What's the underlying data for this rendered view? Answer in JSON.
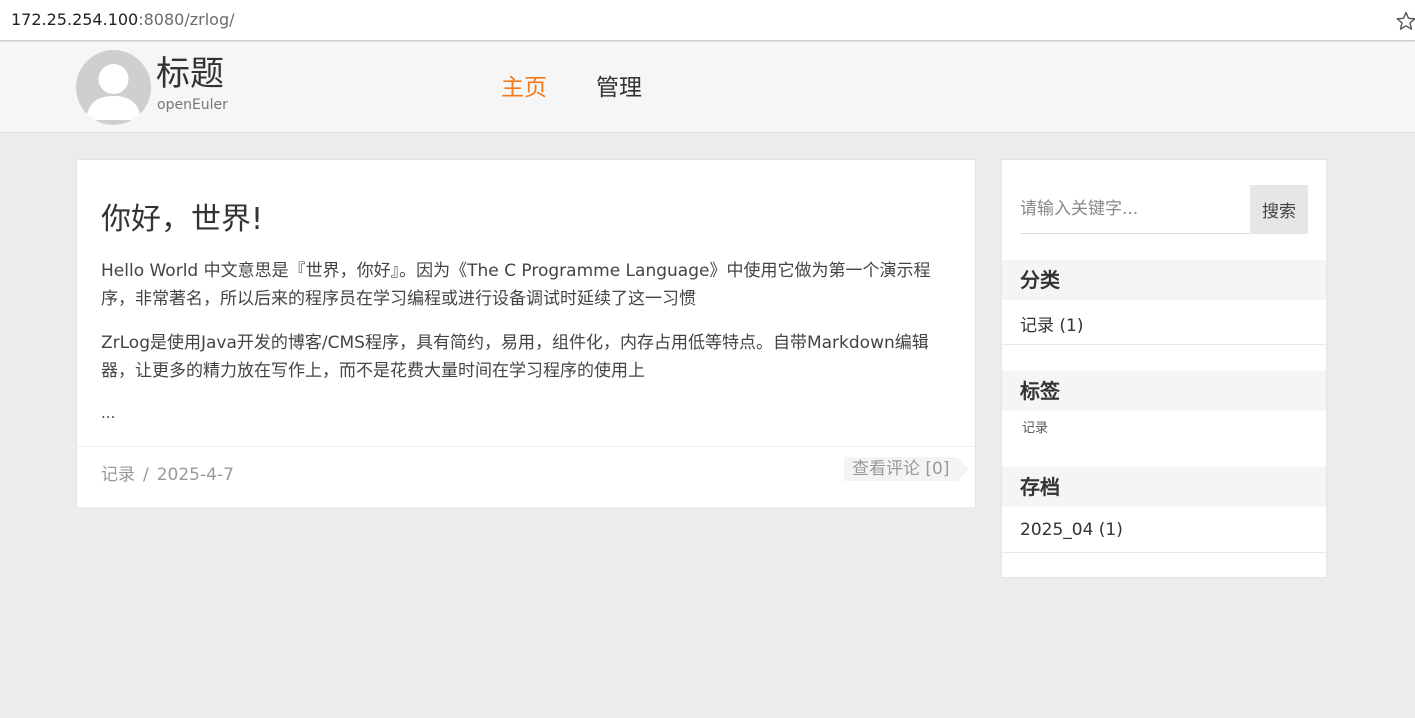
{
  "browser": {
    "url_host": "172.25.254.100",
    "url_rest": ":8080/zrlog/"
  },
  "header": {
    "title": "标题",
    "subtitle": "openEuler",
    "nav": [
      {
        "label": "主页",
        "active": true
      },
      {
        "label": "管理",
        "active": false
      }
    ],
    "accent_color": "#f37b1d"
  },
  "post": {
    "title": "你好，世界!",
    "paragraphs": [
      "Hello World 中文意思是『世界，你好』。因为《The C Programme Language》中使用它做为第一个演示程序，非常著名，所以后来的程序员在学习编程或进行设备调试时延续了这一习惯",
      "ZrLog是使用Java开发的博客/CMS程序，具有简约，易用，组件化，内存占用低等特点。自带Markdown编辑器，让更多的精力放在写作上，而不是花费大量时间在学习程序的使用上"
    ],
    "ellipsis": "...",
    "category": "记录",
    "separator": "/",
    "date": "2025-4-7",
    "comments_link": "查看评论 [0]"
  },
  "sidebar": {
    "search_placeholder": "请输入关键字...",
    "search_button": "搜索",
    "category_heading": "分类",
    "category_item": "记录 (1)",
    "tags_heading": "标签",
    "tag_item": "记录",
    "archive_heading": "存档",
    "archive_item": "2025_04 (1)"
  }
}
